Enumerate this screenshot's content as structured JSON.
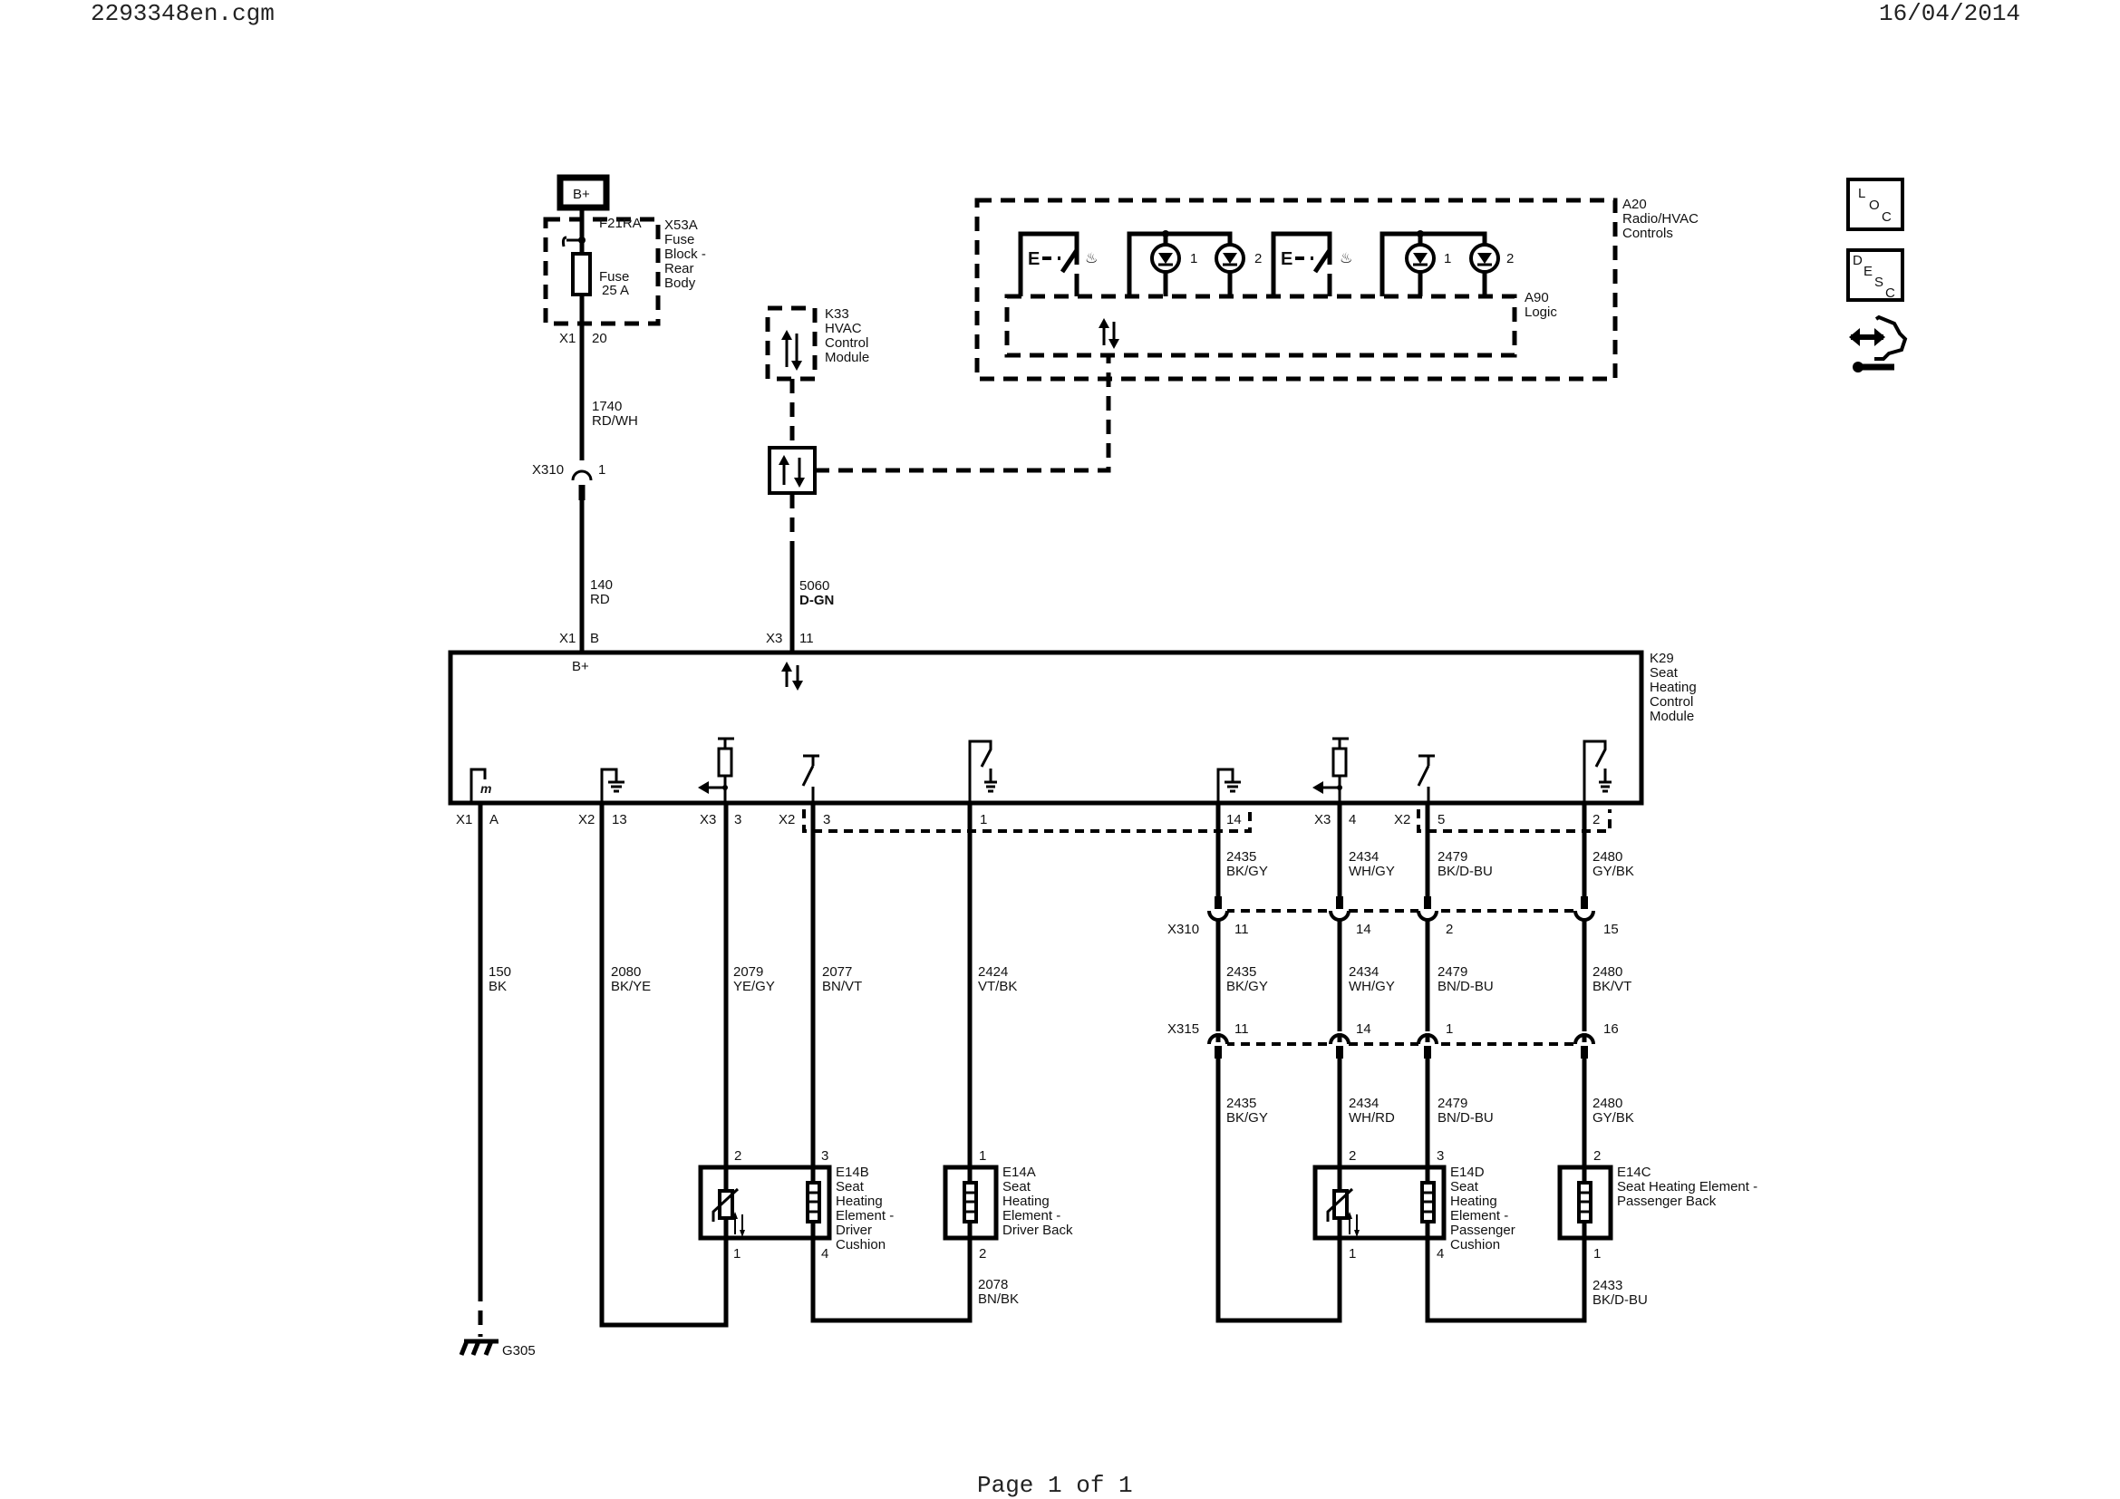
{
  "header": {
    "filename": "2293348en.cgm",
    "date": "16/04/2014"
  },
  "footer": {
    "page": "Page 1 of 1"
  },
  "side_icons": {
    "loc": [
      "L",
      "O",
      "C"
    ],
    "desc": [
      "D",
      "E",
      "S",
      "C"
    ]
  },
  "power": {
    "label": "B+"
  },
  "fuse_block": {
    "title": [
      "X53A",
      "Fuse",
      "Block -",
      "Rear",
      "Body"
    ],
    "fuse": [
      "F21RA",
      "Fuse",
      "25 A"
    ],
    "conn": "X1",
    "pin": "20"
  },
  "k33": {
    "title": [
      "K33",
      "HVAC",
      "Control",
      "Module"
    ]
  },
  "a20": {
    "title": [
      "A20",
      "Radio/HVAC",
      "Controls"
    ],
    "a90": [
      "A90",
      "Logic"
    ],
    "led1": "1",
    "led2": "2",
    "led3": "1",
    "led4": "2"
  },
  "k29": {
    "title": [
      "K29",
      "Seat",
      "Heating",
      "Control",
      "Module"
    ],
    "bplus": "B+"
  },
  "top_wires": [
    {
      "id": "w1740",
      "circuit": "1740",
      "color": "RD/WH"
    },
    {
      "id": "w140",
      "circuit": "140",
      "color": "RD"
    },
    {
      "id": "w5060",
      "circuit": "5060",
      "color": "D-GN"
    }
  ],
  "top_connectors": {
    "x310_left": "X310",
    "x310_pin": "1",
    "x1": "X1",
    "x1_pin": "B",
    "x3": "X3",
    "x3_pin": "11"
  },
  "bottom_pins": [
    {
      "conn": "X1",
      "pin": "A"
    },
    {
      "conn": "X2",
      "pin": "13"
    },
    {
      "conn": "X3",
      "pin": "3"
    },
    {
      "conn": "X2",
      "pin": "3"
    },
    {
      "conn": "",
      "pin": "1"
    },
    {
      "conn": "",
      "pin": "14"
    },
    {
      "conn": "X3",
      "pin": "4"
    },
    {
      "conn": "X2",
      "pin": "5"
    },
    {
      "conn": "",
      "pin": "2"
    }
  ],
  "left_wires": [
    {
      "circuit": "150",
      "color": "BK"
    },
    {
      "circuit": "2080",
      "color": "BK/YE"
    },
    {
      "circuit": "2079",
      "color": "YE/GY"
    },
    {
      "circuit": "2077",
      "color": "BN/VT"
    },
    {
      "circuit": "2424",
      "color": "VT/BK"
    },
    {
      "circuit": "2078",
      "color": "BN/BK"
    }
  ],
  "right_wires_upper": [
    {
      "circuit": "2435",
      "color": "BK/GY"
    },
    {
      "circuit": "2434",
      "color": "WH/GY"
    },
    {
      "circuit": "2479",
      "color": "BK/D-BU"
    },
    {
      "circuit": "2480",
      "color": "GY/BK"
    }
  ],
  "right_wires_mid": [
    {
      "circuit": "2435",
      "color": "BK/GY"
    },
    {
      "circuit": "2434",
      "color": "WH/GY"
    },
    {
      "circuit": "2479",
      "color": "BN/D-BU"
    },
    {
      "circuit": "2480",
      "color": "BK/VT"
    }
  ],
  "right_wires_lower": [
    {
      "circuit": "2435",
      "color": "BK/GY"
    },
    {
      "circuit": "2434",
      "color": "WH/RD"
    },
    {
      "circuit": "2479",
      "color": "BN/D-BU"
    },
    {
      "circuit": "2480",
      "color": "GY/BK"
    },
    {
      "circuit": "2433",
      "color": "BK/D-BU"
    }
  ],
  "x310": {
    "label": "X310",
    "pins": [
      "11",
      "14",
      "2",
      "15"
    ]
  },
  "x315": {
    "label": "X315",
    "pins": [
      "11",
      "14",
      "1",
      "16"
    ]
  },
  "e14b": {
    "title": [
      "E14B",
      "Seat",
      "Heating",
      "Element -",
      "Driver",
      "Cushion"
    ],
    "pins": [
      "2",
      "3",
      "1",
      "4"
    ]
  },
  "e14a": {
    "title": [
      "E14A",
      "Seat",
      "Heating",
      "Element -",
      "Driver Back"
    ],
    "pins": [
      "1",
      "2"
    ]
  },
  "e14d": {
    "title": [
      "E14D",
      "Seat",
      "Heating",
      "Element -",
      "Passenger",
      "Cushion"
    ],
    "pins": [
      "2",
      "3",
      "1",
      "4"
    ]
  },
  "e14c": {
    "title": [
      "E14C",
      "Seat Heating Element -",
      "Passenger Back"
    ],
    "pins": [
      "2",
      "1"
    ]
  },
  "ground": {
    "label": "G305"
  }
}
